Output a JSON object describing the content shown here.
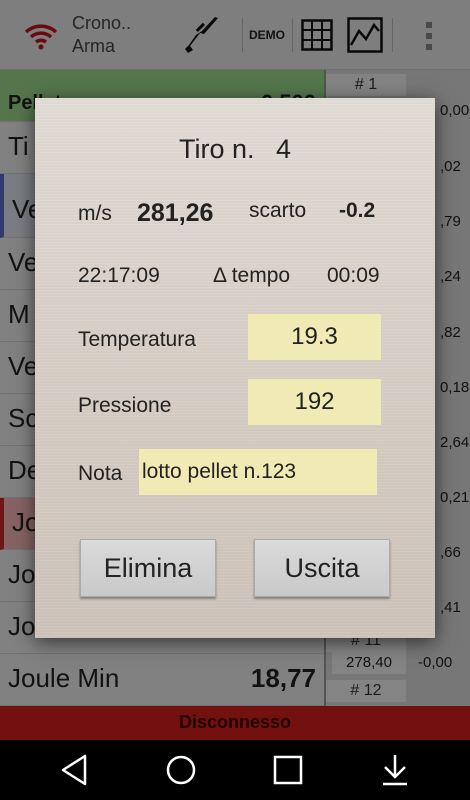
{
  "appbar": {
    "title_line1": "Crono..",
    "title_line2": "Arma",
    "demo_label": "DEMO",
    "icons": [
      "wifi-icon",
      "rifle-icon",
      "grid-icon",
      "chart-icon",
      "overflow-menu-icon"
    ]
  },
  "background": {
    "rows": [
      {
        "label": "Pellet",
        "value": "0,500"
      },
      {
        "label": "Ti",
        "value": ""
      },
      {
        "label": "Ve",
        "value": ""
      },
      {
        "label": "Ve",
        "value": ""
      },
      {
        "label": "M",
        "value": ""
      },
      {
        "label": "Ve",
        "value": ""
      },
      {
        "label": "Sc",
        "value": ""
      },
      {
        "label": "De",
        "value": ""
      },
      {
        "label": "Joule",
        "value": ""
      },
      {
        "label": "Jo",
        "value": ""
      },
      {
        "label": "Jo",
        "value": ""
      },
      {
        "label": "Joule Min",
        "value": "18,77"
      }
    ],
    "shots": [
      {
        "header": "# 1",
        "cells": [
          "0,00"
        ]
      },
      {
        "header": "",
        "cells": [
          ",02"
        ]
      },
      {
        "header": "",
        "cells": [
          ",79"
        ]
      },
      {
        "header": "",
        "cells": [
          ",24"
        ]
      },
      {
        "header": "",
        "cells": [
          ",82"
        ]
      },
      {
        "header": "",
        "cells": [
          "0,18"
        ]
      },
      {
        "header": "",
        "cells": [
          "2,64"
        ]
      },
      {
        "header": "",
        "cells": [
          "0,21"
        ]
      },
      {
        "header": "",
        "cells": [
          ",66"
        ]
      },
      {
        "header": "",
        "cells": [
          ",41"
        ]
      },
      {
        "header": "# 11",
        "cells": [
          "278,40",
          "-0,00"
        ]
      },
      {
        "header": "# 12",
        "cells": []
      }
    ],
    "status": "Disconnesso"
  },
  "dialog": {
    "title_label": "Tiro n.",
    "shot_number": "4",
    "speed_unit": "m/s",
    "speed_value": "281,26",
    "deviation_label": "scarto",
    "deviation_value": "-0.2",
    "time_value": "22:17:09",
    "delta_label": "Δ tempo",
    "delta_value": "00:09",
    "temperature_label": "Temperatura",
    "temperature_value": "19.3",
    "pressure_label": "Pressione",
    "pressure_value": "192",
    "note_label": "Nota",
    "note_value": "lotto pellet n.123",
    "delete_button": "Elimina",
    "exit_button": "Uscita"
  },
  "navbar": {
    "icons": [
      "back-icon",
      "home-icon",
      "recents-icon",
      "download-icon"
    ]
  }
}
